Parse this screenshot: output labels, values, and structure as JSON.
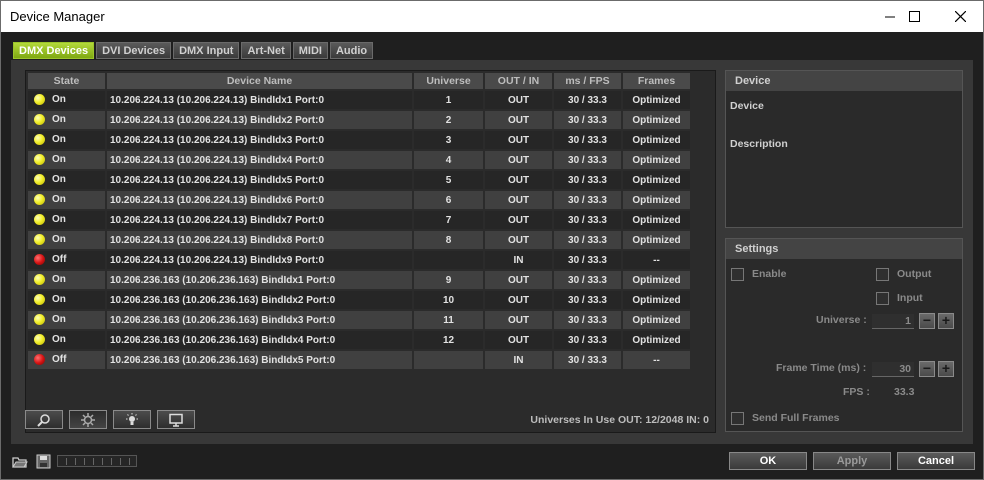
{
  "window": {
    "title": "Device Manager",
    "controls": {
      "minimize": "minimize",
      "maximize": "maximize",
      "close": "close"
    }
  },
  "tabs": [
    {
      "label": "DMX Devices",
      "active": true
    },
    {
      "label": "DVI Devices",
      "active": false
    },
    {
      "label": "DMX Input",
      "active": false
    },
    {
      "label": "Art-Net",
      "active": false
    },
    {
      "label": "MIDI",
      "active": false
    },
    {
      "label": "Audio",
      "active": false
    }
  ],
  "table": {
    "headers": [
      "State",
      "Device Name",
      "Universe",
      "OUT / IN",
      "ms / FPS",
      "Frames"
    ],
    "rows": [
      {
        "state": "On",
        "led": "on",
        "name": "10.206.224.13 (10.206.224.13) BindIdx1 Port:0",
        "universe": "1",
        "direction": "OUT",
        "ms_fps": "30 / 33.3",
        "frames": "Optimized"
      },
      {
        "state": "On",
        "led": "on",
        "name": "10.206.224.13 (10.206.224.13) BindIdx2 Port:0",
        "universe": "2",
        "direction": "OUT",
        "ms_fps": "30 / 33.3",
        "frames": "Optimized"
      },
      {
        "state": "On",
        "led": "on",
        "name": "10.206.224.13 (10.206.224.13) BindIdx3 Port:0",
        "universe": "3",
        "direction": "OUT",
        "ms_fps": "30 / 33.3",
        "frames": "Optimized"
      },
      {
        "state": "On",
        "led": "on",
        "name": "10.206.224.13 (10.206.224.13) BindIdx4 Port:0",
        "universe": "4",
        "direction": "OUT",
        "ms_fps": "30 / 33.3",
        "frames": "Optimized"
      },
      {
        "state": "On",
        "led": "on",
        "name": "10.206.224.13 (10.206.224.13) BindIdx5 Port:0",
        "universe": "5",
        "direction": "OUT",
        "ms_fps": "30 / 33.3",
        "frames": "Optimized"
      },
      {
        "state": "On",
        "led": "on",
        "name": "10.206.224.13 (10.206.224.13) BindIdx6 Port:0",
        "universe": "6",
        "direction": "OUT",
        "ms_fps": "30 / 33.3",
        "frames": "Optimized"
      },
      {
        "state": "On",
        "led": "on",
        "name": "10.206.224.13 (10.206.224.13) BindIdx7 Port:0",
        "universe": "7",
        "direction": "OUT",
        "ms_fps": "30 / 33.3",
        "frames": "Optimized"
      },
      {
        "state": "On",
        "led": "on",
        "name": "10.206.224.13 (10.206.224.13) BindIdx8 Port:0",
        "universe": "8",
        "direction": "OUT",
        "ms_fps": "30 / 33.3",
        "frames": "Optimized"
      },
      {
        "state": "Off",
        "led": "off",
        "name": "10.206.224.13 (10.206.224.13) BindIdx9 Port:0",
        "universe": "",
        "direction": "IN",
        "ms_fps": "30 / 33.3",
        "frames": "--"
      },
      {
        "state": "On",
        "led": "on",
        "name": "10.206.236.163 (10.206.236.163) BindIdx1 Port:0",
        "universe": "9",
        "direction": "OUT",
        "ms_fps": "30 / 33.3",
        "frames": "Optimized"
      },
      {
        "state": "On",
        "led": "on",
        "name": "10.206.236.163 (10.206.236.163) BindIdx2 Port:0",
        "universe": "10",
        "direction": "OUT",
        "ms_fps": "30 / 33.3",
        "frames": "Optimized"
      },
      {
        "state": "On",
        "led": "on",
        "name": "10.206.236.163 (10.206.236.163) BindIdx3 Port:0",
        "universe": "11",
        "direction": "OUT",
        "ms_fps": "30 / 33.3",
        "frames": "Optimized"
      },
      {
        "state": "On",
        "led": "on",
        "name": "10.206.236.163 (10.206.236.163) BindIdx4 Port:0",
        "universe": "12",
        "direction": "OUT",
        "ms_fps": "30 / 33.3",
        "frames": "Optimized"
      },
      {
        "state": "Off",
        "led": "off",
        "name": "10.206.236.163 (10.206.236.163) BindIdx5 Port:0",
        "universe": "",
        "direction": "IN",
        "ms_fps": "30 / 33.3",
        "frames": "--"
      }
    ]
  },
  "toolbar": {
    "icons": [
      "search-icon",
      "gear-icon",
      "lightbulb-icon",
      "monitor-icon"
    ],
    "usage_text": "Universes In Use OUT: 12/2048  IN: 0"
  },
  "device_group": {
    "title": "Device",
    "device_label": "Device",
    "description_label": "Description"
  },
  "settings_group": {
    "title": "Settings",
    "enable_label": "Enable",
    "output_label": "Output",
    "input_label": "Input",
    "universe_label": "Universe :",
    "universe_value": "1",
    "frame_time_label": "Frame Time (ms) :",
    "frame_time_value": "30",
    "fps_label": "FPS :",
    "fps_value": "33.3",
    "send_full_frames_label": "Send Full Frames",
    "minus": "−",
    "plus": "+"
  },
  "buttons": {
    "ok": "OK",
    "apply": "Apply",
    "cancel": "Cancel"
  },
  "colors": {
    "active_tab": "#8fbc1c",
    "led_on": "#f2ef2b",
    "led_off": "#d81515"
  }
}
